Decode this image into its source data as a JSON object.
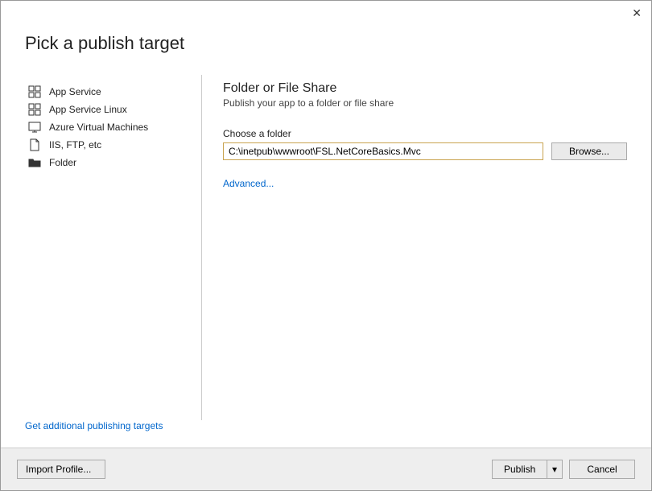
{
  "title": "Pick a publish target",
  "close_glyph": "✕",
  "sidebar": {
    "items": [
      {
        "label": "App Service"
      },
      {
        "label": "App Service Linux"
      },
      {
        "label": "Azure Virtual Machines"
      },
      {
        "label": "IIS, FTP, etc"
      },
      {
        "label": "Folder"
      }
    ]
  },
  "main": {
    "heading": "Folder or File Share",
    "subheading": "Publish your app to a folder or file share",
    "folder_label": "Choose a folder",
    "folder_value": "C:\\inetpub\\wwwroot\\FSL.NetCoreBasics.Mvc",
    "browse_label": "Browse...",
    "advanced_label": "Advanced..."
  },
  "targets_link": "Get additional publishing targets",
  "footer": {
    "import_label": "Import Profile...",
    "publish_label": "Publish",
    "dropdown_glyph": "▾",
    "cancel_label": "Cancel"
  }
}
